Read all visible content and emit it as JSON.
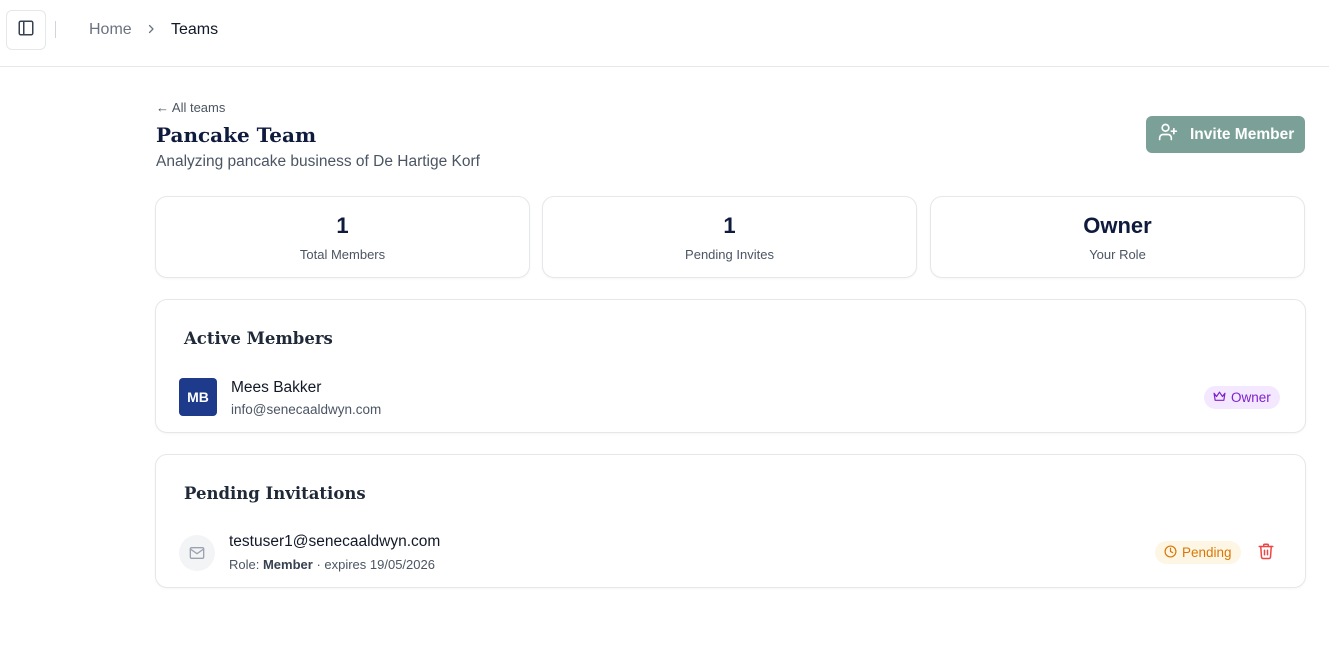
{
  "breadcrumb": {
    "home": "Home",
    "current": "Teams"
  },
  "header": {
    "back_link": "← All teams",
    "title": "Pancake Team",
    "description": "Analyzing pancake business of De Hartige Korf",
    "invite_button": "Invite Member"
  },
  "stats": [
    {
      "value": "1",
      "label": "Total Members"
    },
    {
      "value": "1",
      "label": "Pending Invites"
    },
    {
      "value": "Owner",
      "label": "Your Role"
    }
  ],
  "active_members": {
    "title": "Active Members",
    "members": [
      {
        "initials": "MB",
        "name": "Mees Bakker",
        "email": "info@senecaaldwyn.com",
        "role": "Owner"
      }
    ]
  },
  "pending_invitations": {
    "title": "Pending Invitations",
    "invites": [
      {
        "email": "testuser1@senecaaldwyn.com",
        "role_prefix": "Role: ",
        "role": "Member",
        "expires": " · expires 19/05/2026",
        "status": "Pending"
      }
    ]
  },
  "icons": {
    "sidebar_toggle": "panel-left-icon",
    "chevron": "chevron-right-icon",
    "invite": "user-plus-icon",
    "owner": "crown-icon",
    "mail": "mail-icon",
    "pending": "clock-icon",
    "delete": "trash-icon"
  },
  "colors": {
    "accent": "#7aa097",
    "avatar": "#1e3a8a",
    "owner_badge_bg": "#f3e8ff",
    "owner_badge_text": "#7e22ce",
    "pending_badge_bg": "#fef6e4",
    "pending_badge_text": "#d97706",
    "delete": "#ef4444"
  }
}
